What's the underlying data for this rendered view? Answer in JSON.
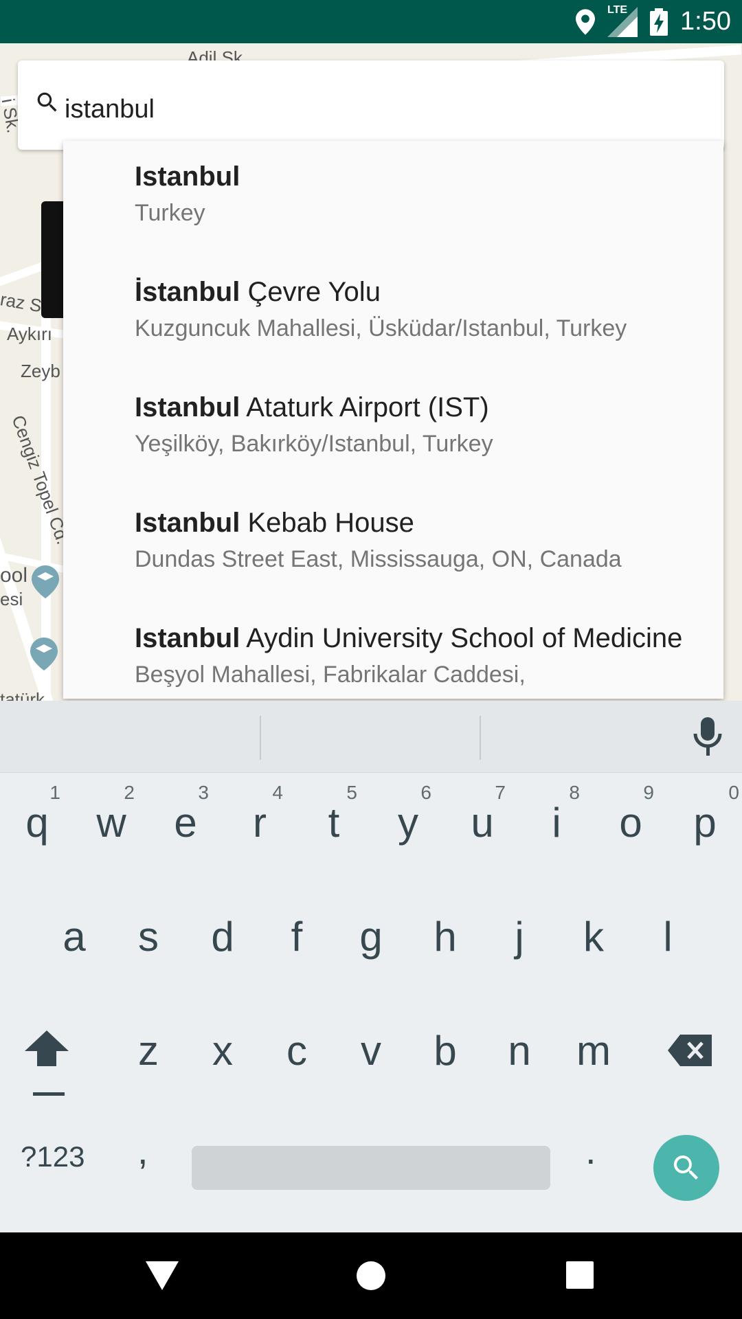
{
  "status_bar": {
    "time": "1:50",
    "network_label": "LTE",
    "icons": [
      "location-icon",
      "signal-icon",
      "battery-charging-icon"
    ]
  },
  "map": {
    "labels": [
      "Adil Sk.",
      "raz Sk.",
      "Aykırı",
      "Zeyb",
      "Cengiz Topel Cd.",
      "ool",
      "esi",
      "tatürk",
      "i Sk."
    ]
  },
  "search": {
    "value": "istanbul",
    "placeholder": ""
  },
  "suggestions": [
    {
      "match": "Istanbul",
      "rest": "",
      "secondary": "Turkey"
    },
    {
      "match": "İstanbul",
      "rest": " Çevre Yolu",
      "secondary": "Kuzguncuk Mahallesi, Üsküdar/Istanbul, Turkey"
    },
    {
      "match": "Istanbul",
      "rest": " Ataturk Airport (IST)",
      "secondary": "Yeşilköy, Bakırköy/Istanbul, Turkey"
    },
    {
      "match": "Istanbul",
      "rest": " Kebab House",
      "secondary": "Dundas Street East, Mississauga, ON, Canada"
    },
    {
      "match": "Istanbul",
      "rest": " Aydin University School of Medicine",
      "secondary": "Beşyol Mahallesi, Fabrikalar Caddesi,"
    }
  ],
  "keyboard": {
    "row1": [
      {
        "ch": "q",
        "hint": "1"
      },
      {
        "ch": "w",
        "hint": "2"
      },
      {
        "ch": "e",
        "hint": "3"
      },
      {
        "ch": "r",
        "hint": "4"
      },
      {
        "ch": "t",
        "hint": "5"
      },
      {
        "ch": "y",
        "hint": "6"
      },
      {
        "ch": "u",
        "hint": "7"
      },
      {
        "ch": "i",
        "hint": "8"
      },
      {
        "ch": "o",
        "hint": "9"
      },
      {
        "ch": "p",
        "hint": "0"
      }
    ],
    "row2": [
      "a",
      "s",
      "d",
      "f",
      "g",
      "h",
      "j",
      "k",
      "l"
    ],
    "row3": [
      "z",
      "x",
      "c",
      "v",
      "b",
      "n",
      "m"
    ],
    "symbols_label": "?123",
    "comma_label": ",",
    "period_label": ".",
    "action": "search-icon",
    "accent_color": "#4db6ac"
  },
  "colors": {
    "status_bar": "#00574b",
    "keyboard_bg": "#eceff1",
    "nav_bar": "#000000"
  }
}
